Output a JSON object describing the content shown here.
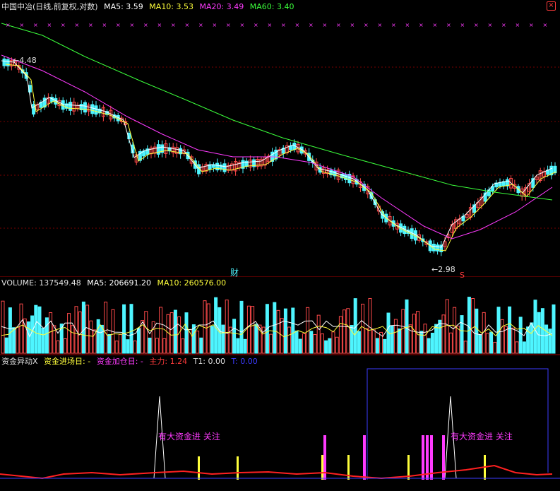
{
  "colors": {
    "bg": "#000000",
    "up": "#ff4a4a",
    "down": "#4ef5ff",
    "ma5": "#ffffff",
    "ma10": "#ffff3b",
    "ma20": "#ff3bff",
    "ma60": "#3bff3b",
    "grid": "#7a0000",
    "blue": "#3b3bff",
    "yellow": "#ffff3b",
    "magenta": "#ff3bff",
    "red": "#ff2020"
  },
  "header": {
    "title": "中国中冶(日线,前复权,对数)",
    "ma5": "MA5: 3.59",
    "ma10": "MA10: 3.53",
    "ma20": "MA20: 3.49",
    "ma60": "MA60: 3.40"
  },
  "price_labels": {
    "high": "4.48",
    "low": "2.98",
    "fin_marker": "财",
    "s_marker": "S"
  },
  "volume_header": {
    "label": "VOLUME: 137549.48",
    "ma5": "MA5: 206691.20",
    "ma10": "MA10: 260576.00"
  },
  "indicator_header": {
    "name": "资金异动X",
    "entry": "资金进场日: -",
    "add": "资金加仓日: -",
    "main": "主力: 1.24",
    "t1": "T1: 0.00",
    "t": "T: 0.00"
  },
  "annotations": [
    "有大资金进 关注",
    "有大资金进 关注"
  ],
  "icons": {
    "close": "close-icon"
  }
}
